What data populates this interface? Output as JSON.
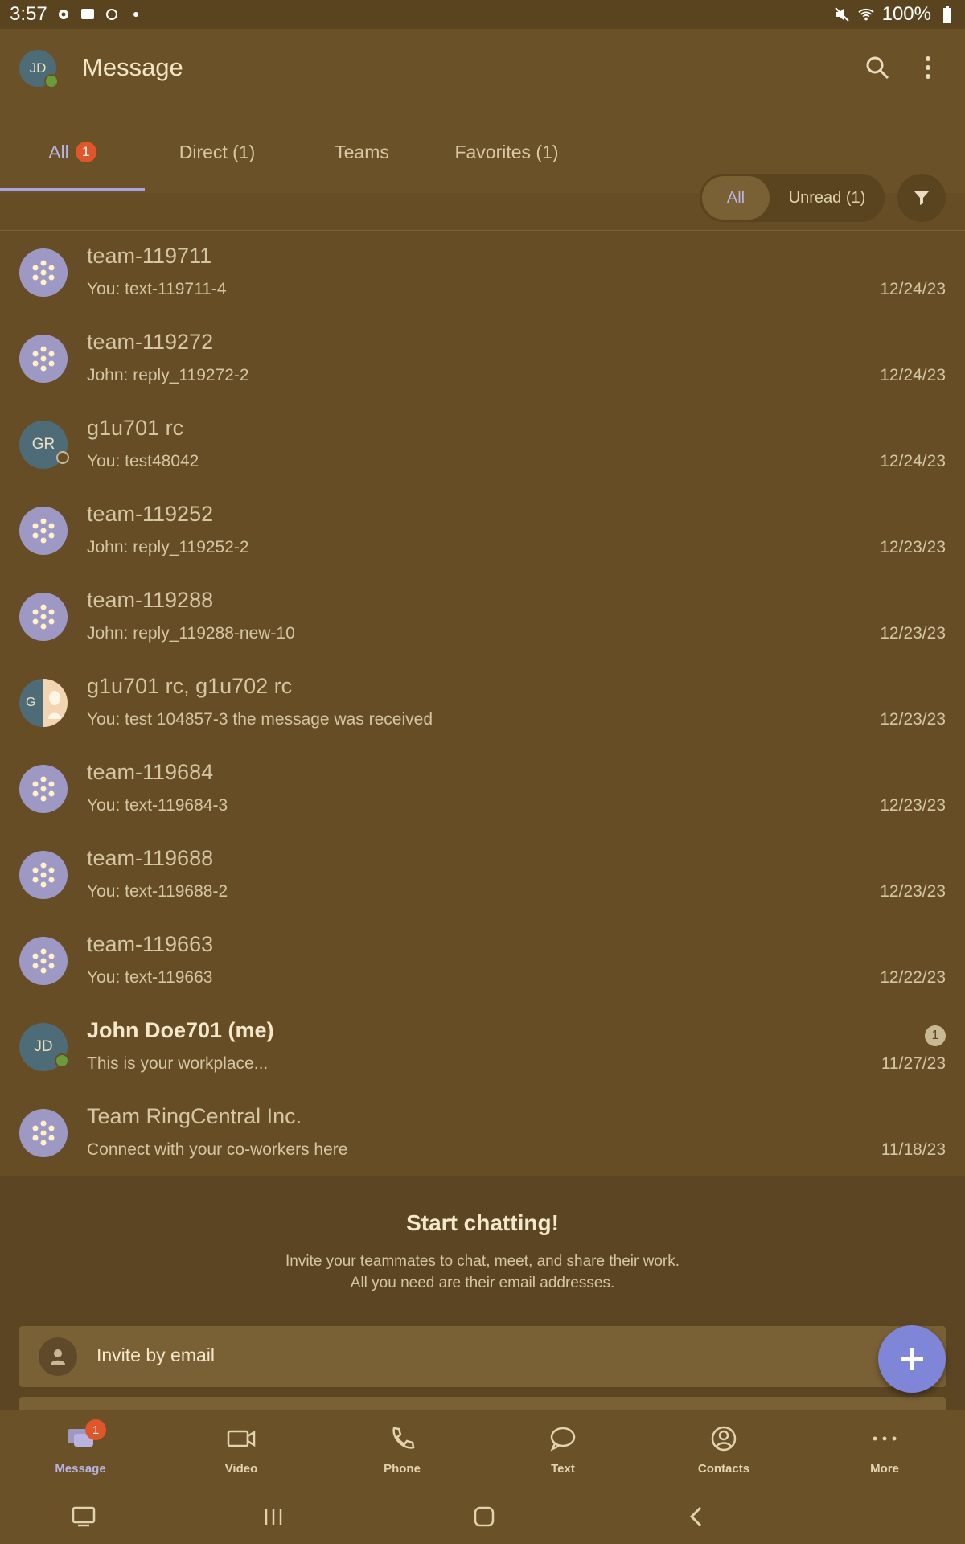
{
  "status_bar": {
    "time": "3:57",
    "battery": "100%"
  },
  "header": {
    "avatar_initials": "JD",
    "title": "Message"
  },
  "tabs": [
    {
      "label": "All",
      "badge": "1"
    },
    {
      "label": "Direct (1)"
    },
    {
      "label": "Teams"
    },
    {
      "label": "Favorites (1)"
    }
  ],
  "filters": {
    "all": "All",
    "unread": "Unread (1)"
  },
  "conversations": [
    {
      "title": "team-119711",
      "preview": "You: text-119711-4",
      "date": "12/24/23",
      "avatar": "team"
    },
    {
      "title": "team-119272",
      "preview": "John: reply_119272-2",
      "date": "12/24/23",
      "avatar": "team"
    },
    {
      "title": "g1u701 rc",
      "preview": "You: test48042",
      "date": "12/24/23",
      "avatar": "GR"
    },
    {
      "title": "team-119252",
      "preview": "John: reply_119252-2",
      "date": "12/23/23",
      "avatar": "team"
    },
    {
      "title": "team-119288",
      "preview": "John: reply_119288-new-10",
      "date": "12/23/23",
      "avatar": "team"
    },
    {
      "title": "g1u701 rc, g1u702 rc",
      "preview": "You: test 104857-3 the message was received",
      "date": "12/23/23",
      "avatar": "G"
    },
    {
      "title": "team-119684",
      "preview": "You: text-119684-3",
      "date": "12/23/23",
      "avatar": "team"
    },
    {
      "title": "team-119688",
      "preview": "You: text-119688-2",
      "date": "12/23/23",
      "avatar": "team"
    },
    {
      "title": "team-119663",
      "preview": "You: text-119663",
      "date": "12/22/23",
      "avatar": "team"
    },
    {
      "title": "John Doe701 (me)",
      "preview": "This is your workplace...",
      "date": "11/27/23",
      "avatar": "JD",
      "unread": "1"
    },
    {
      "title": "Team RingCentral Inc.",
      "preview": "Connect with your co-workers here",
      "date": "11/18/23",
      "avatar": "team"
    }
  ],
  "empty_state": {
    "title": "Start chatting!",
    "line1": "Invite your teammates to chat, meet, and share their work.",
    "line2": "All you need are their email addresses.",
    "invite_label": "Invite by email"
  },
  "bottom_nav": [
    {
      "label": "Message",
      "icon": "message-icon",
      "badge": "1"
    },
    {
      "label": "Video",
      "icon": "video-icon"
    },
    {
      "label": "Phone",
      "icon": "phone-icon"
    },
    {
      "label": "Text",
      "icon": "text-icon"
    },
    {
      "label": "Contacts",
      "icon": "contacts-icon"
    },
    {
      "label": "More",
      "icon": "more-icon"
    }
  ],
  "colors": {
    "background": "#664d26",
    "accent": "#7f86d8",
    "badge": "#e0562b",
    "presence": "#6a9a3a"
  }
}
